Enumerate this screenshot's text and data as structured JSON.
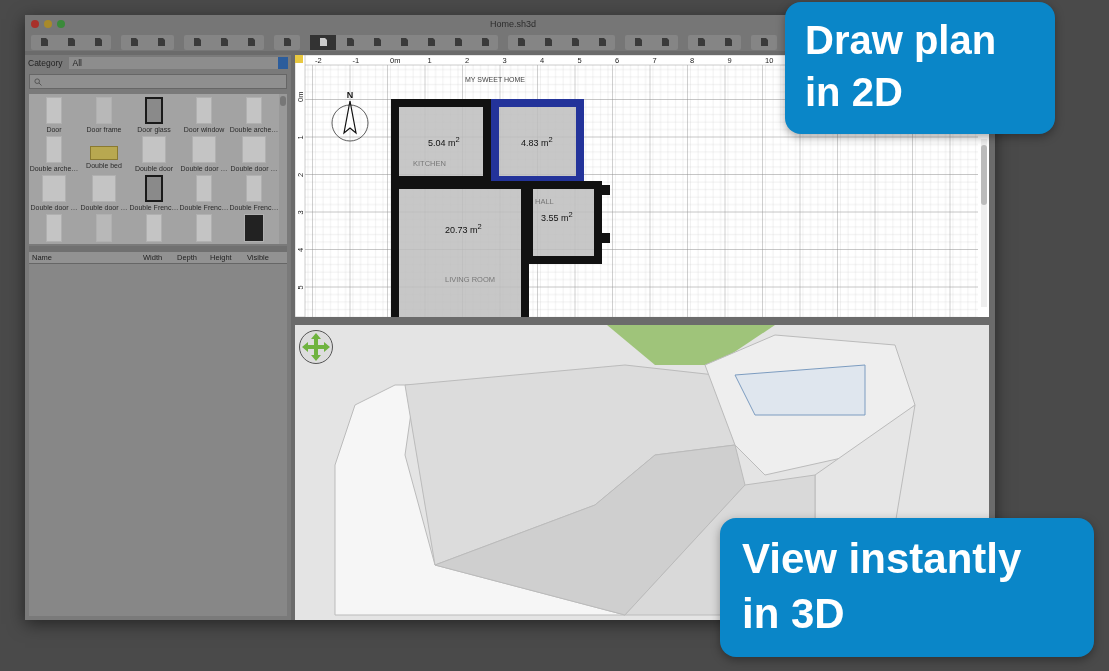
{
  "window": {
    "title": "Home.sh3d"
  },
  "toolbar": [
    [
      {
        "selected": false
      },
      {
        "selected": false
      },
      {
        "selected": false
      }
    ],
    [
      {
        "selected": false
      },
      {
        "selected": false
      }
    ],
    [
      {
        "selected": false
      },
      {
        "selected": false
      },
      {
        "selected": false
      }
    ],
    [
      {
        "selected": false
      }
    ],
    [
      {
        "selected": true
      },
      {
        "selected": false
      },
      {
        "selected": false
      },
      {
        "selected": false
      },
      {
        "selected": false
      },
      {
        "selected": false
      },
      {
        "selected": false
      }
    ],
    [
      {
        "selected": false
      },
      {
        "selected": false
      },
      {
        "selected": false
      },
      {
        "selected": false
      }
    ],
    [
      {
        "selected": false
      },
      {
        "selected": false
      }
    ],
    [
      {
        "selected": false
      },
      {
        "selected": false
      }
    ],
    [
      {
        "selected": false
      }
    ]
  ],
  "catalog": {
    "category_label": "Category",
    "category_value": "All",
    "items": [
      {
        "label": "Door",
        "kind": "door"
      },
      {
        "label": "Door frame",
        "kind": "frame"
      },
      {
        "label": "Door glass",
        "kind": "glass"
      },
      {
        "label": "Door window",
        "kind": "door"
      },
      {
        "label": "Double arche…",
        "kind": "door"
      },
      {
        "label": "Double arche…",
        "kind": "door"
      },
      {
        "label": "Double bed",
        "kind": "bed"
      },
      {
        "label": "Double door",
        "kind": "wide"
      },
      {
        "label": "Double door …",
        "kind": "wide"
      },
      {
        "label": "Double door …",
        "kind": "wide"
      },
      {
        "label": "Double door …",
        "kind": "wide"
      },
      {
        "label": "Double door …",
        "kind": "wide"
      },
      {
        "label": "Double Frenc…",
        "kind": "glass"
      },
      {
        "label": "Double Frenc…",
        "kind": "door"
      },
      {
        "label": "Double Frenc…",
        "kind": "door"
      }
    ]
  },
  "furniture_table": {
    "columns": [
      "Name",
      "Width",
      "Depth",
      "Height",
      "Visible"
    ]
  },
  "plan": {
    "title": "MY SWEET HOME",
    "compass": "N",
    "x_ruler": [
      "-2",
      "-1",
      "0m",
      "1",
      "2",
      "3",
      "4",
      "5",
      "6",
      "7",
      "8",
      "9",
      "10"
    ],
    "y_ruler": [
      "0m",
      "1",
      "2",
      "3",
      "4",
      "5"
    ],
    "rooms": [
      {
        "area": "5.04 m$^{2}$",
        "name": "KITCHEN",
        "selected": false
      },
      {
        "area": "4.83 m$^{2}$",
        "selected": true
      },
      {
        "area": "20.73 m$^{2}$",
        "name": "LIVING ROOM",
        "selected": false
      },
      {
        "area": "3.55 m$^{2}$",
        "name": "HALL",
        "selected": false
      }
    ]
  },
  "callouts": [
    {
      "text": "Draw plan\nin 2D"
    },
    {
      "text": "View instantly\nin 3D"
    }
  ]
}
